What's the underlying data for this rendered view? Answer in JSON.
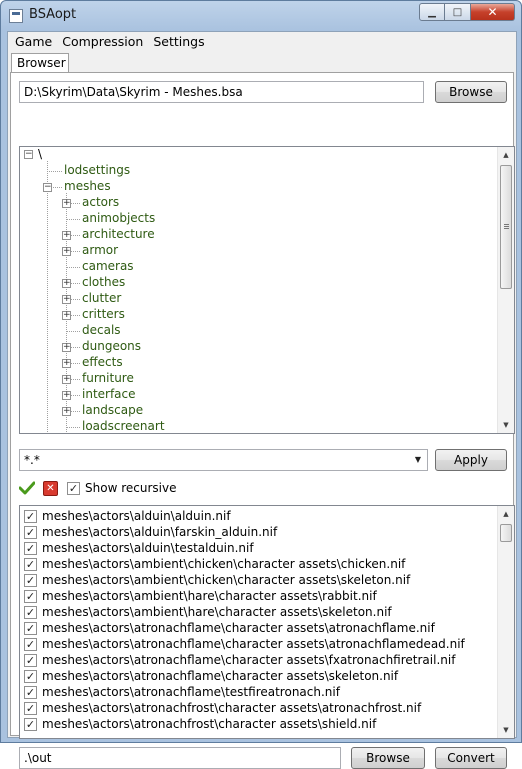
{
  "window": {
    "title": "BSAopt",
    "min_glyph": "▁",
    "max_glyph": "□",
    "close_glyph": "✕"
  },
  "menu": [
    "Game",
    "Compression",
    "Settings"
  ],
  "tab": "Browser",
  "archive": {
    "path": "D:\\Skyrim\\Data\\Skyrim - Meshes.bsa",
    "browse_label": "Browse"
  },
  "tree": {
    "root": "\\",
    "items": [
      {
        "label": "lodsettings",
        "level": 1,
        "expander": "none"
      },
      {
        "label": "meshes",
        "level": 1,
        "expander": "open"
      },
      {
        "label": "actors",
        "level": 2,
        "expander": "closed"
      },
      {
        "label": "animobjects",
        "level": 2,
        "expander": "none"
      },
      {
        "label": "architecture",
        "level": 2,
        "expander": "closed"
      },
      {
        "label": "armor",
        "level": 2,
        "expander": "closed"
      },
      {
        "label": "cameras",
        "level": 2,
        "expander": "none"
      },
      {
        "label": "clothes",
        "level": 2,
        "expander": "closed"
      },
      {
        "label": "clutter",
        "level": 2,
        "expander": "closed"
      },
      {
        "label": "critters",
        "level": 2,
        "expander": "closed"
      },
      {
        "label": "decals",
        "level": 2,
        "expander": "none"
      },
      {
        "label": "dungeons",
        "level": 2,
        "expander": "closed"
      },
      {
        "label": "effects",
        "level": 2,
        "expander": "closed"
      },
      {
        "label": "furniture",
        "level": 2,
        "expander": "closed"
      },
      {
        "label": "interface",
        "level": 2,
        "expander": "closed"
      },
      {
        "label": "landscape",
        "level": 2,
        "expander": "closed"
      },
      {
        "label": "loadscreenart",
        "level": 2,
        "expander": "none"
      }
    ]
  },
  "filter": {
    "value": "*.*",
    "apply_label": "Apply"
  },
  "show_recursive": {
    "label": "Show recursive",
    "checked": true
  },
  "files": [
    {
      "name": "meshes\\actors\\alduin\\alduin.nif",
      "checked": true
    },
    {
      "name": "meshes\\actors\\alduin\\farskin_alduin.nif",
      "checked": true
    },
    {
      "name": "meshes\\actors\\alduin\\testalduin.nif",
      "checked": true
    },
    {
      "name": "meshes\\actors\\ambient\\chicken\\character assets\\chicken.nif",
      "checked": true
    },
    {
      "name": "meshes\\actors\\ambient\\chicken\\character assets\\skeleton.nif",
      "checked": true
    },
    {
      "name": "meshes\\actors\\ambient\\hare\\character assets\\rabbit.nif",
      "checked": true
    },
    {
      "name": "meshes\\actors\\ambient\\hare\\character assets\\skeleton.nif",
      "checked": true
    },
    {
      "name": "meshes\\actors\\atronachflame\\character assets\\atronachflame.nif",
      "checked": true
    },
    {
      "name": "meshes\\actors\\atronachflame\\character assets\\atronachflamedead.nif",
      "checked": true
    },
    {
      "name": "meshes\\actors\\atronachflame\\character assets\\fxatronachfiretrail.nif",
      "checked": true
    },
    {
      "name": "meshes\\actors\\atronachflame\\character assets\\skeleton.nif",
      "checked": true
    },
    {
      "name": "meshes\\actors\\atronachflame\\testfireatronach.nif",
      "checked": true
    },
    {
      "name": "meshes\\actors\\atronachfrost\\character assets\\atronachfrost.nif",
      "checked": true
    },
    {
      "name": "meshes\\actors\\atronachfrost\\character assets\\shield.nif",
      "checked": true
    }
  ],
  "output": {
    "path": ".\\out",
    "browse_label": "Browse",
    "convert_label": "Convert"
  },
  "colors": {
    "tree_text": "#2e5a12",
    "accent_green": "#4a9a1c",
    "accent_red": "#d83a2f"
  }
}
